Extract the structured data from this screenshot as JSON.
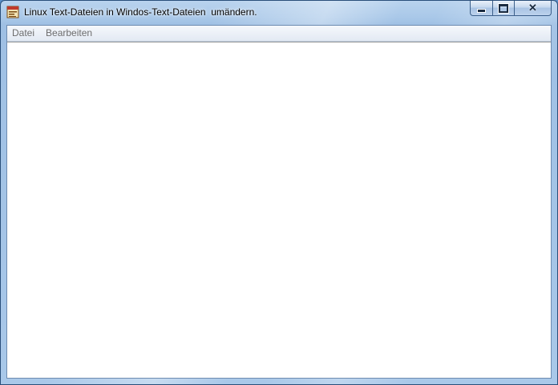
{
  "window": {
    "title": "Linux Text-Dateien in Windos-Text-Dateien  umändern.",
    "icon": "app-icon",
    "buttons": {
      "minimize_icon": "minimize-icon",
      "maximize_icon": "maximize-icon",
      "close_icon": "close-icon"
    }
  },
  "menubar": {
    "items": [
      {
        "label": "Datei"
      },
      {
        "label": "Bearbeiten"
      }
    ]
  },
  "colors": {
    "titlebar": "#a8c7e8",
    "client_bg": "#ffffff",
    "menu_text": "#6d6d6d"
  }
}
